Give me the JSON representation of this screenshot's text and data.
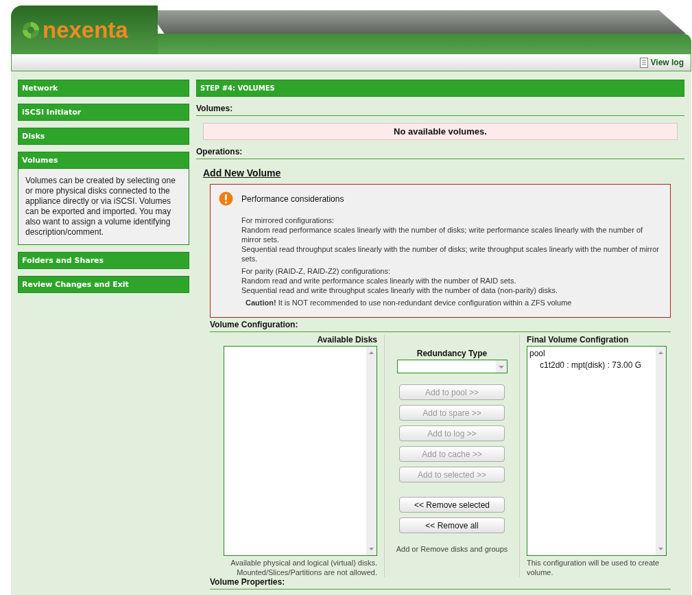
{
  "header": {
    "logo": "nexenta",
    "view_log": "View log"
  },
  "sidebar": {
    "items": [
      {
        "label": "Network"
      },
      {
        "label": "iSCSI Initiator"
      },
      {
        "label": "Disks"
      },
      {
        "label": "Volumes",
        "description": "Volumes can be created by selecting one or more physical disks connected to the appliance directly or via iSCSI. Volumes can be exported and imported. You may also want to assign a volume identifying description/comment."
      },
      {
        "label": "Folders and Shares"
      },
      {
        "label": "Review Changes and Exit"
      }
    ]
  },
  "main": {
    "step_title": "STEP #4: VOLUMES",
    "volumes_label": "Volumes:",
    "no_volumes": "No available volumes.",
    "operations_label": "Operations:",
    "add_volume_title": "Add New Volume",
    "alert": {
      "title": "Performance considerations",
      "paragraphs": [
        {
          "lines": [
            "For mirrored configurations:",
            "Random read performance scales linearly with the number of disks; write performance scales linearly with the number of mirror sets.",
            "Sequential read throughput scales linearly with the number of disks; write throughput scales linearly with the number of mirror sets."
          ]
        },
        {
          "lines": [
            "For parity (RAID-Z, RAID-Z2) configurations:",
            "Random read and write performance scales linearly with the number of RAID sets.",
            "Sequential read and write throughput scales linearly with the number of data (non-parity) disks."
          ]
        }
      ],
      "caution": "**Caution!** It is NOT recommended to use non-redundant device configuration within a ZFS volume"
    },
    "volume_config_label": "Volume Configuration:",
    "available_disks": {
      "heading": "Available Disks",
      "hint": "Available physical and logical (virtual) disks. Mounted/Slices/Partitions are not allowed."
    },
    "redundancy": {
      "label": "Redundancy Type"
    },
    "add_buttons": [
      {
        "label": "Add to pool >>",
        "disabled": true
      },
      {
        "label": "Add to spare >>",
        "disabled": true
      },
      {
        "label": "Add to log >>",
        "disabled": true
      },
      {
        "label": "Add to cache >>",
        "disabled": true
      },
      {
        "label": "Add to selected >>",
        "disabled": true
      }
    ],
    "remove_buttons": [
      {
        "label": "<< Remove selected",
        "disabled": false
      },
      {
        "label": "<< Remove all",
        "disabled": false
      }
    ],
    "buttons_hint": "Add or Remove disks and groups",
    "final_config": {
      "heading": "Final Volume Configration",
      "tree": [
        {
          "label": "pool",
          "children": [
            {
              "label": "c1t2d0 : mpt(disk) : 73.00 G"
            }
          ]
        }
      ],
      "hint": "This configuration will be used to create volume."
    },
    "volume_properties_label": "Volume Properties:"
  }
}
